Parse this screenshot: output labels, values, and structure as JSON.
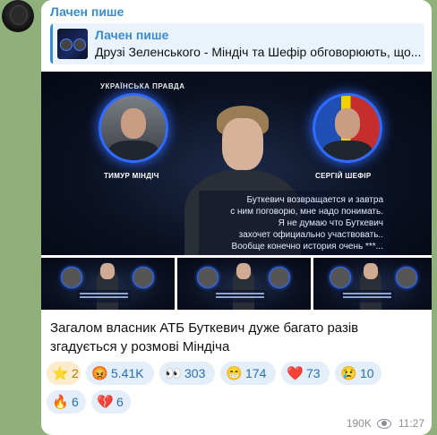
{
  "channel": {
    "name": "Лачен пише"
  },
  "reply": {
    "title": "Лачен пише",
    "text": "Друзі Зеленського - Міндіч та Шефір обговорюють, що..."
  },
  "media": {
    "brand": "УКРАЇНСЬКА ПРАВДА",
    "left_name": "ТИМУР МІНДІЧ",
    "right_name": "СЕРГІЙ ШЕФІР",
    "subtitle_lines": [
      "Буткевич возвращается и завтра",
      "с ним поговорю, мне надо понимать.",
      "Я не думаю что Буткевич",
      "захочет официально участвовать..",
      "Вообще конечно история очень ***..."
    ],
    "thumb_count": 3
  },
  "caption": "Загалом власник АТБ Буткевич дуже багато разів згадується у розмові Міндіча",
  "reactions": [
    {
      "emoji": "⭐",
      "icon": "star-icon",
      "count": "2",
      "paid": true
    },
    {
      "emoji": "😡",
      "icon": "angry-face-icon",
      "count": "5.41K",
      "paid": false
    },
    {
      "emoji": "👀",
      "icon": "eyes-icon",
      "count": "303",
      "paid": false
    },
    {
      "emoji": "😁",
      "icon": "grin-face-icon",
      "count": "174",
      "paid": false
    },
    {
      "emoji": "❤️",
      "icon": "heart-icon",
      "count": "73",
      "paid": false
    },
    {
      "emoji": "😢",
      "icon": "crying-face-icon",
      "count": "10",
      "paid": false
    },
    {
      "emoji": "🔥",
      "icon": "fire-icon",
      "count": "6",
      "paid": false
    },
    {
      "emoji": "💔",
      "icon": "broken-heart-icon",
      "count": "6",
      "paid": false
    }
  ],
  "meta": {
    "views": "190K",
    "time": "11:27"
  }
}
